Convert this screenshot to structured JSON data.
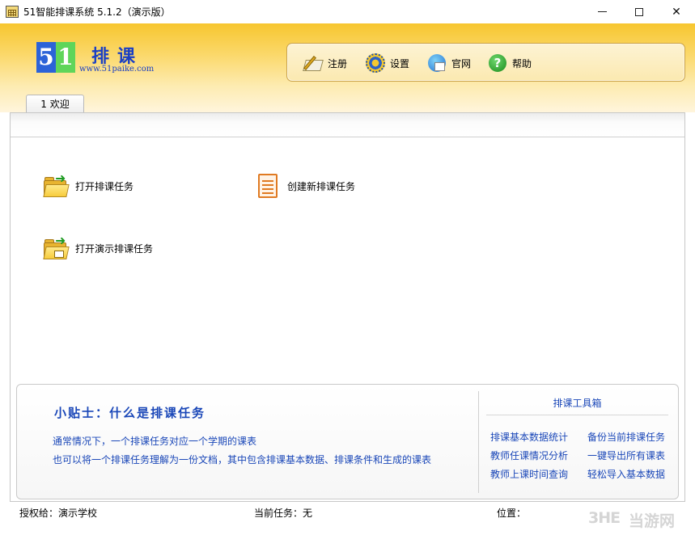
{
  "window": {
    "title": "51智能排课系统 5.1.2（演示版）",
    "min_icon": "minimize-icon",
    "max_icon": "maximize-icon",
    "close_icon": "close-icon",
    "close_glyph": "✕"
  },
  "logo": {
    "digit1": "5",
    "digit2": "1",
    "name": "排课",
    "url": "www.51paike.com"
  },
  "toolbar": {
    "items": [
      {
        "label": "注册",
        "icon": "register-pen-icon"
      },
      {
        "label": "设置",
        "icon": "settings-gear-icon"
      },
      {
        "label": "官网",
        "icon": "website-globe-icon"
      },
      {
        "label": "帮助",
        "icon": "help-icon",
        "glyph": "?"
      }
    ]
  },
  "tabs": [
    {
      "label": "1 欢迎",
      "active": true
    }
  ],
  "actions": {
    "open_task": "打开排课任务",
    "new_task": "创建新排课任务",
    "open_demo": "打开演示排课任务"
  },
  "tips": {
    "title": "小贴士：什么是排课任务",
    "line1": "通常情况下，一个排课任务对应一个学期的课表",
    "line2": "也可以将一个排课任务理解为一份文档，其中包含排课基本数据、排课条件和生成的课表"
  },
  "tools": {
    "title": "排课工具箱",
    "links": [
      "排课基本数据统计",
      "备份当前排课任务",
      "教师任课情况分析",
      "一键导出所有课表",
      "教师上课时间查询",
      "轻松导入基本数据"
    ]
  },
  "status": {
    "licensed": "授权给：演示学校",
    "current_task": "当前任务：无",
    "position": "位置："
  },
  "watermark": {
    "mark": "3HE",
    "text": "当游网"
  },
  "colors": {
    "accent_blue": "#1a47b8",
    "header_yellow": "#f7c62f"
  }
}
